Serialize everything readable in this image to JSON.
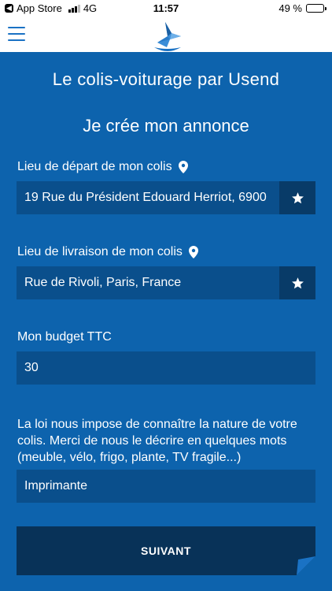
{
  "status_bar": {
    "carrier": "App Store",
    "network": "4G",
    "time": "11:57",
    "battery_percent_label": "49 %",
    "battery_level": 0.49
  },
  "header": {
    "menu_icon": "hamburger-menu-icon",
    "logo_icon": "bird-logo-icon"
  },
  "page": {
    "title": "Le colis-voiturage par Usend",
    "subtitle": "Je crée mon annonce"
  },
  "departure": {
    "label": "Lieu de départ de mon colis",
    "value": "19 Rue du Président Edouard Herriot, 6900",
    "icon": "location-pin-icon"
  },
  "delivery": {
    "label": "Lieu de livraison de mon colis",
    "value": "Rue de Rivoli, Paris, France",
    "icon": "location-pin-icon"
  },
  "budget": {
    "label": "Mon budget TTC",
    "value": "30"
  },
  "description": {
    "text": "La loi nous impose de connaître la nature de votre colis. Merci de nous le décrire en quelques mots (meuble, vélo, frigo, plante, TV fragile...)",
    "value": "Imprimante"
  },
  "next_button": {
    "label": "SUIVANT"
  },
  "colors": {
    "background": "#0d63ad",
    "field": "#0a4f8c",
    "star_button": "#083b68",
    "next_button": "#083258"
  }
}
